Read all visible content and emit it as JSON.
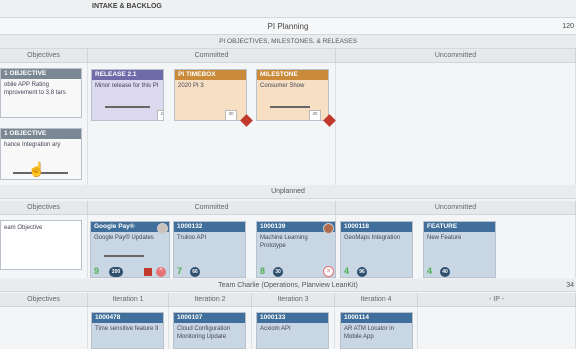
{
  "top_band": {
    "title": "INTAKE & BACKLOG"
  },
  "pi_band": {
    "title": "PI Planning",
    "right_count": "120"
  },
  "objectives_band": {
    "title": "PI OBJECTIVES, MILESTONES, & RELEASES"
  },
  "columns_row1": {
    "objectives": "Objectives",
    "committed": "Committed",
    "uncommitted": "Uncommitted"
  },
  "objective_cards": [
    {
      "header": "1 OBJECTIVE",
      "body": "obile APP Rating mprovement to 3.8 tars"
    },
    {
      "header": "1 OBJECTIVE",
      "body": "hance Integration ary"
    }
  ],
  "milestone_cards": [
    {
      "header": "RELEASE 2.1",
      "body": "Minor release for this PI",
      "date": "29"
    },
    {
      "header": "PI TIMEBOX",
      "body": "2020 PI 3",
      "date": "30"
    },
    {
      "header": "MILESTONE",
      "body": "Consumer Show",
      "date": "30"
    }
  ],
  "unplanned_band": {
    "title": "Unplanned"
  },
  "columns_row2": {
    "objectives": "Objectives",
    "committed": "Committed",
    "uncommitted": "Uncommitted"
  },
  "team_objective": {
    "body": "eam Objective"
  },
  "feature_cards": [
    {
      "header": "Google Pay®",
      "body": "Google Pay® Updates",
      "count": "9",
      "points": "200"
    },
    {
      "header": "1000132",
      "body": "Trulioo API",
      "count": "7",
      "points": "66"
    },
    {
      "header": "1000139",
      "body": "Machine Learning Prototype",
      "count": "8",
      "points": "30"
    },
    {
      "header": "1000118",
      "body": "GeoMaps Integration",
      "count": "4",
      "points": "96"
    },
    {
      "header": "FEATURE",
      "body": "New Feature",
      "count": "4",
      "points": "40"
    }
  ],
  "team_band": {
    "title": "Team Charlie (Operations, Planview LeanKit)",
    "right_count": "34"
  },
  "columns_row3": {
    "objectives": "Objectives",
    "iter1": "Iteration 1",
    "iter2": "Iteration 2",
    "iter3": "Iteration 3",
    "iter4": "Iteration 4",
    "ip": "- IP -"
  },
  "iteration_cards": [
    {
      "header": "1000478",
      "body": "Time sensitive feature II"
    },
    {
      "header": "1000107",
      "body": "Cloud Configuration Monitoring Update"
    },
    {
      "header": "1000133",
      "body": "Acxiom API"
    },
    {
      "header": "1000114",
      "body": "AR ATM Locator in Mobile App"
    }
  ],
  "colors": {
    "accent_green": "#4caf50",
    "alert_red": "#c0392b",
    "card_blue": "#3f6f9a"
  }
}
